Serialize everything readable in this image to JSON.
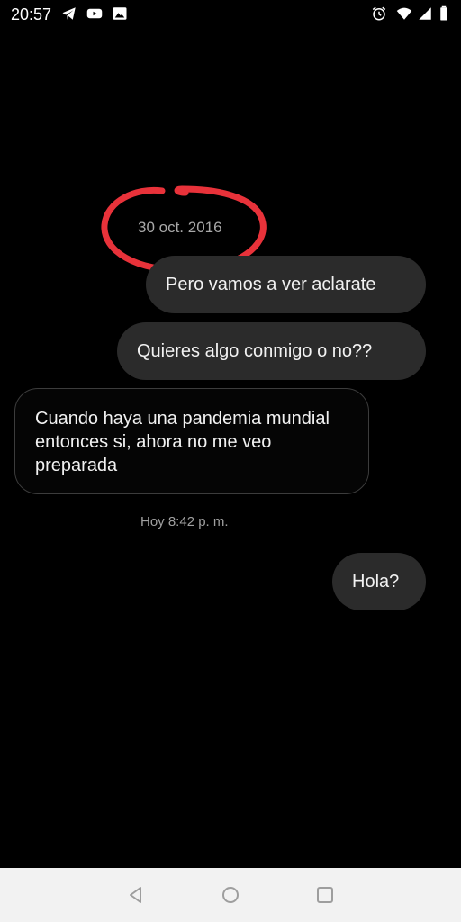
{
  "status_bar": {
    "time": "20:57",
    "left_icons": [
      "telegram-icon",
      "youtube-icon",
      "image-icon"
    ],
    "right_icons": [
      "alarm-icon",
      "wifi-icon",
      "signal-icon",
      "battery-icon"
    ]
  },
  "chat": {
    "date_stamp": "30 oct. 2016",
    "highlight_color": "#e8323a",
    "messages": [
      {
        "direction": "sent",
        "text": "Pero vamos a ver aclarate"
      },
      {
        "direction": "sent",
        "text": "Quieres algo conmigo o no??"
      },
      {
        "direction": "received",
        "text": "Cuando haya una pandemia mundial entonces si, ahora no me veo preparada"
      },
      {
        "direction": "sent",
        "text": "Hola?"
      }
    ],
    "time_stamp": "Hoy 8:42 p. m."
  },
  "nav_bar": {
    "buttons": [
      "back-icon",
      "home-icon",
      "recents-icon"
    ]
  }
}
